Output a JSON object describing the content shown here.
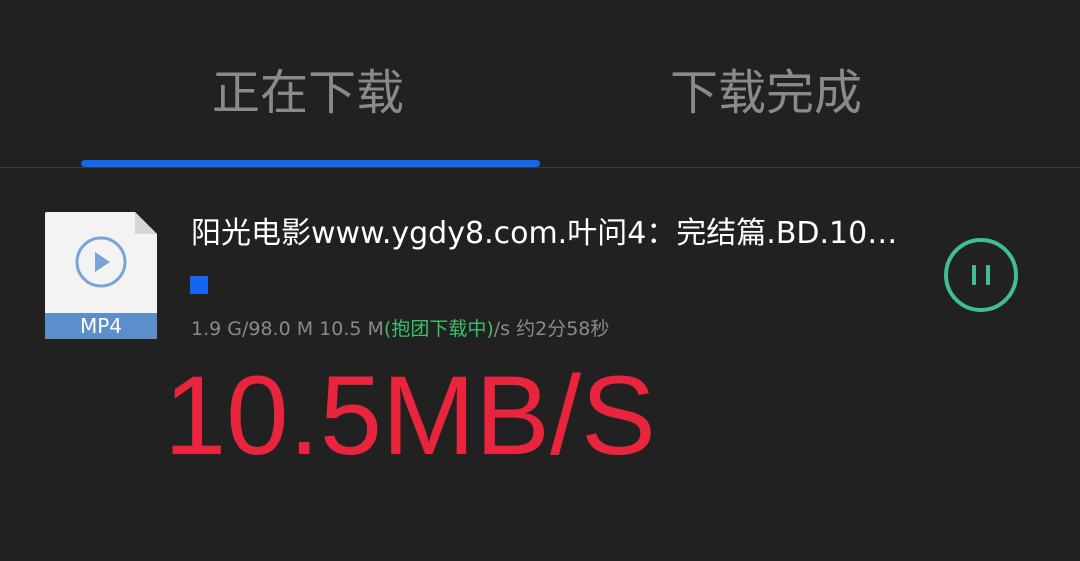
{
  "tabs": [
    {
      "label": "正在下载",
      "active": true
    },
    {
      "label": "下载完成",
      "active": false
    }
  ],
  "colors": {
    "background": "#212121",
    "accent": "#1565f0",
    "pause_ring": "#3fbf8f",
    "group_status": "#3dbf6a",
    "speed_overlay": "#e8253c"
  },
  "download": {
    "file_type": "MP4",
    "file_icon": "video-file-icon",
    "file_name": "阳光电影www.ygdy8.com.叶问4：完结篇.BD.10…",
    "progress_percent": 0,
    "sizes": "1.9 G/98.0 M",
    "speed_value": "10.5 M",
    "group_status": "(抱团下载中)",
    "speed_unit": "/s",
    "remaining": "约2分58秒",
    "action_icon": "pause-icon"
  },
  "overlay": {
    "speed_text": "10.5MB/S"
  }
}
